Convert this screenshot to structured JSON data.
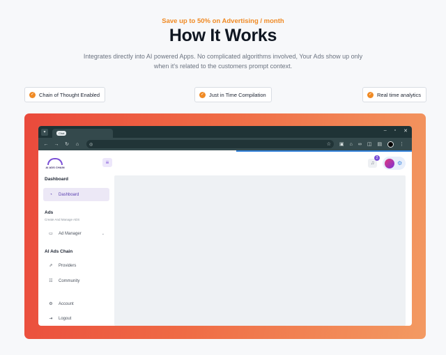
{
  "header": {
    "eyebrow": "Save up to 50% on Advertising / month",
    "title": "How It Works",
    "subtitle": "Integrates directly into AI powered Apps. No complicated algorithms involved, Your Ads show up only when it's related to the customers prompt context."
  },
  "features": [
    {
      "label": "Chain of Thought Enabled",
      "icon": "check-circle-icon"
    },
    {
      "label": "Just in Time Compilation",
      "icon": "check-circle-icon"
    },
    {
      "label": "Real time analytics",
      "icon": "check-circle-icon"
    }
  ],
  "browser": {
    "tab_label": "Chat",
    "window_controls": [
      "–",
      "▫",
      "✕"
    ]
  },
  "app": {
    "logo_text": "AI ADS CHAIN",
    "notification_count": "2",
    "sidebar": {
      "section_dashboard": "Dashboard",
      "dashboard_item": "Dashboard",
      "section_ads": "Ads",
      "section_ads_sub": "Create And Manage ADS",
      "ad_manager_item": "Ad Manager",
      "section_chain": "AI Ads Chain",
      "providers_item": "Providers",
      "community_item": "Community",
      "account_item": "Account",
      "logout_item": "Logout"
    }
  },
  "colors": {
    "accent_orange": "#f08a24",
    "brand_purple": "#7b4fd6",
    "gradient_start": "#ea4a3c",
    "gradient_end": "#f39a62"
  }
}
